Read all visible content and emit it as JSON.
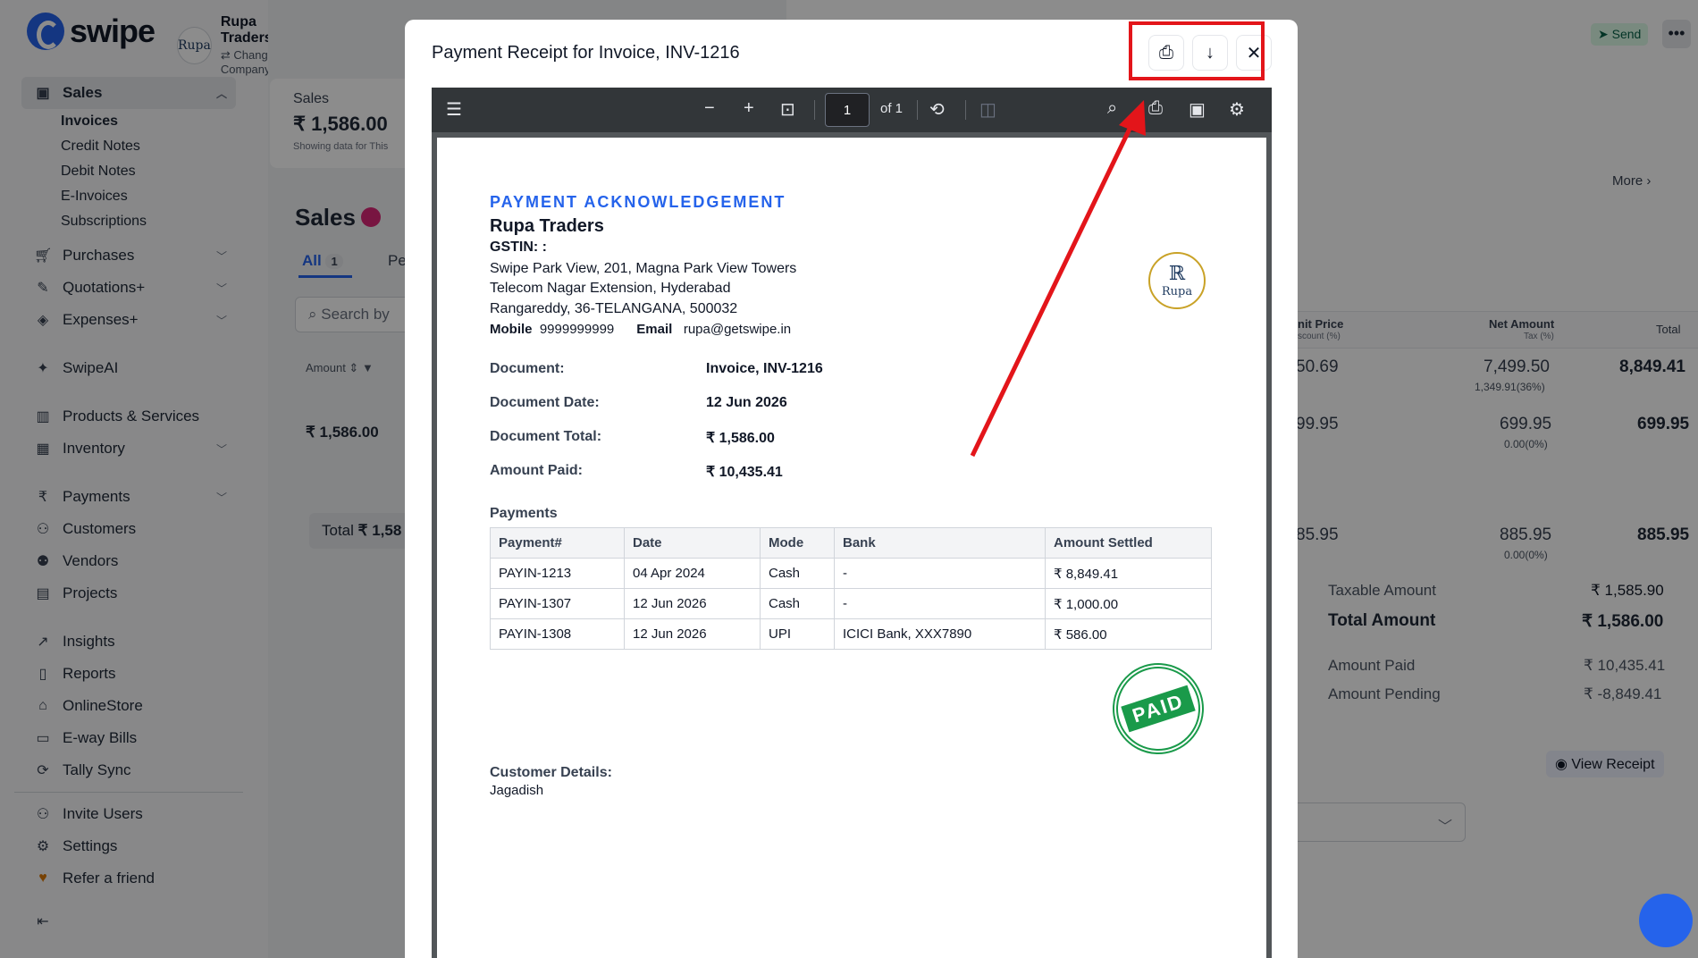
{
  "brand": {
    "name": "swipe"
  },
  "company": {
    "name": "Rupa Traders",
    "change_label": "Change Company",
    "avatar_text": "Rupa"
  },
  "sidebar": {
    "sales": {
      "label": "Sales",
      "sub": [
        "Invoices",
        "Credit Notes",
        "Debit Notes",
        "E-Invoices",
        "Subscriptions"
      ]
    },
    "items": [
      "Purchases",
      "Quotations+",
      "Expenses+",
      "SwipeAI",
      "Products & Services",
      "Inventory",
      "Payments",
      "Customers",
      "Vendors",
      "Projects",
      "Insights",
      "Reports",
      "OnlineStore",
      "E-way Bills",
      "Tally Sync",
      "Invite Users",
      "Settings",
      "Refer a friend"
    ]
  },
  "middle": {
    "card_label": "Sales",
    "card_value": "₹ 1,586.00",
    "card_note": "Showing data for This",
    "heading": "Sales",
    "tab_all": "All",
    "tab_all_count": "1",
    "tab_pending": "Pe",
    "search_placeholder": "Search by",
    "col_amount": "Amount",
    "row_amount": "₹ 1,586.00",
    "total_label": "Total",
    "total_value": "₹ 1,58"
  },
  "right": {
    "send_label": "Send",
    "more_label": "More",
    "headers": {
      "unit_price": "nit Price",
      "discount": "scount (%)",
      "net_amount": "Net Amount",
      "tax": "Tax (%)",
      "total": "Total"
    },
    "rows": [
      {
        "price": "50.69",
        "net": "7,499.50",
        "tax": "1,349.91(36%)",
        "total": "8,849.41"
      },
      {
        "price": "99.95",
        "net": "699.95",
        "tax": "0.00(0%)",
        "total": "699.95"
      },
      {
        "price": "85.95",
        "net": "885.95",
        "tax": "0.00(0%)",
        "total": "885.95"
      }
    ],
    "taxable_label": "Taxable Amount",
    "taxable_value": "₹ 1,585.90",
    "total_label": "Total Amount",
    "total_value": "₹ 1,586.00",
    "paid_label": "Amount Paid",
    "paid_value": "₹ 10,435.41",
    "pending_label": "Amount Pending",
    "pending_value": "₹ -8,849.41",
    "view_receipt": "View Receipt"
  },
  "modal": {
    "title": "Payment Receipt for Invoice, INV-1216",
    "viewer": {
      "page": "1",
      "of": "of 1"
    },
    "doc": {
      "heading": "PAYMENT ACKNOWLEDGEMENT",
      "company": "Rupa Traders",
      "gstin": "GSTIN: :",
      "address1": "Swipe Park View, 201, Magna Park View Towers",
      "address2": "Telecom Nagar Extension, Hyderabad",
      "address3": "Rangareddy, 36-TELANGANA, 500032",
      "mobile_label": "Mobile",
      "mobile": "9999999999",
      "email_label": "Email",
      "email": "rupa@getswipe.in",
      "logo_text": "Rupa",
      "fields": [
        {
          "label": "Document:",
          "value": "Invoice, INV-1216"
        },
        {
          "label": "Document Date:",
          "value": "12 Jun 2026"
        },
        {
          "label": "Document Total:",
          "value": "₹ 1,586.00"
        },
        {
          "label": "Amount Paid:",
          "value": "₹ 10,435.41"
        }
      ],
      "payments_label": "Payments",
      "columns": [
        "Payment#",
        "Date",
        "Mode",
        "Bank",
        "Amount Settled"
      ],
      "payments": [
        [
          "PAYIN-1213",
          "04 Apr 2024",
          "Cash",
          "-",
          "₹ 8,849.41"
        ],
        [
          "PAYIN-1307",
          "12 Jun 2026",
          "Cash",
          "-",
          "₹ 1,000.00"
        ],
        [
          "PAYIN-1308",
          "12 Jun 2026",
          "UPI",
          "ICICI Bank, XXX7890",
          "₹ 586.00"
        ]
      ],
      "stamp_text": "PAID",
      "customer_label": "Customer Details:",
      "customer": "Jagadish"
    }
  },
  "colors": {
    "accent": "#2563eb",
    "annotation": "#e3151a",
    "stamp": "#1a9a4a"
  }
}
